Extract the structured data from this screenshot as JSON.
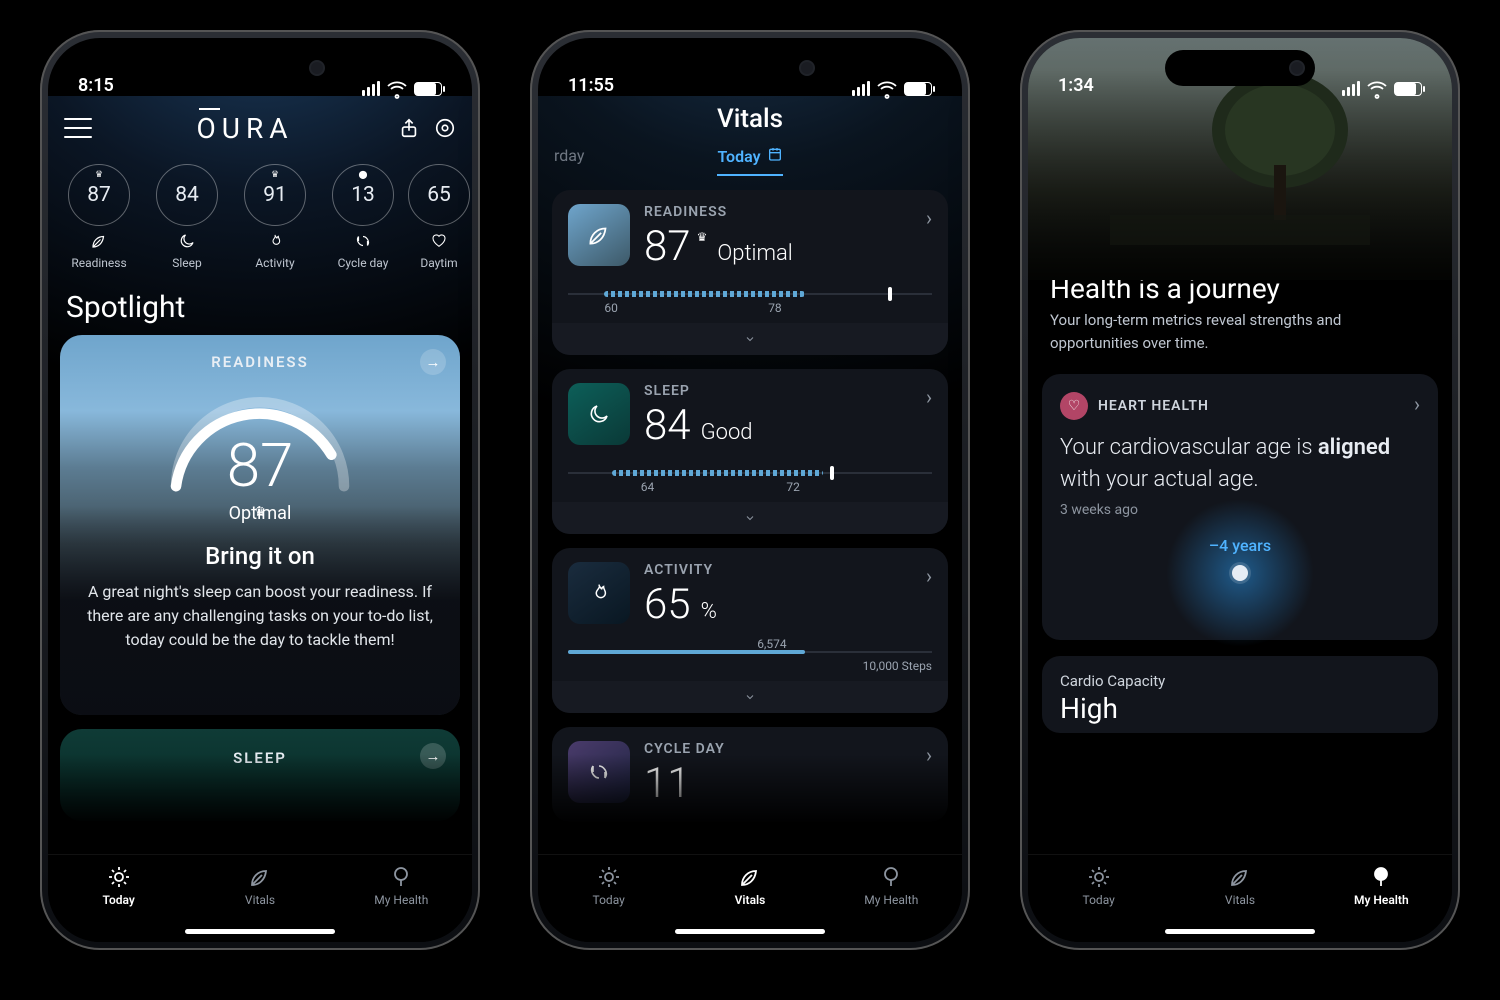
{
  "phones": {
    "p1": {
      "time": "8:15",
      "logo": "OURA",
      "rings": [
        {
          "value": "87",
          "label": "Readiness",
          "crown": true,
          "glyph": "leaf"
        },
        {
          "value": "84",
          "label": "Sleep",
          "crown": false,
          "glyph": "moon"
        },
        {
          "value": "91",
          "label": "Activity",
          "crown": true,
          "glyph": "flame"
        },
        {
          "value": "13",
          "label": "Cycle day",
          "crown": false,
          "glyph": "cycle",
          "topglyph": "mic"
        },
        {
          "value": "65",
          "label": "Daytim",
          "crown": false,
          "glyph": "heart"
        }
      ],
      "spotlight_title": "Spotlight",
      "readiness_card": {
        "label": "READINESS",
        "score": "87",
        "status": "Optimal",
        "headline": "Bring it on",
        "blurb": "A great night's sleep can boost your readiness. If there are any challenging tasks on your to-do list, today could be the day to tackle them!"
      },
      "sleep_card": {
        "label": "SLEEP"
      },
      "tabs": {
        "today": "Today",
        "vitals": "Vitals",
        "health": "My Health"
      }
    },
    "p2": {
      "time": "11:55",
      "title": "Vitals",
      "yesterday_tab": "rday",
      "today_tab": "Today",
      "items": [
        {
          "key": "readiness",
          "label": "READINESS",
          "value": "87",
          "status": "Optimal",
          "crown": true,
          "tick_low": "60",
          "tick_high": "78"
        },
        {
          "key": "sleep",
          "label": "SLEEP",
          "value": "84",
          "status": "Good",
          "crown": false,
          "tick_low": "64",
          "tick_high": "72"
        },
        {
          "key": "activity",
          "label": "ACTIVITY",
          "value": "65",
          "unit": "%",
          "goal_val": "6,574",
          "goal_text": "10,000 Steps"
        },
        {
          "key": "cycle",
          "label": "CYCLE DAY",
          "value": "11"
        }
      ],
      "tabs": {
        "today": "Today",
        "vitals": "Vitals",
        "health": "My Health"
      }
    },
    "p3": {
      "time": "1:34",
      "title": "My Health",
      "sub": "Health is a journey",
      "sub2": "Your long-term metrics reveal strengths and opportunities over time.",
      "heart": {
        "label": "HEART HEALTH",
        "text_pre": "Your cardiovascular age is ",
        "text_bold": "aligned",
        "text_post": " with your actual age.",
        "when": "3 weeks ago",
        "years": "–4 years"
      },
      "cardio": {
        "label": "Cardio Capacity",
        "value": "High"
      },
      "tabs": {
        "today": "Today",
        "vitals": "Vitals",
        "health": "My Health"
      }
    }
  }
}
